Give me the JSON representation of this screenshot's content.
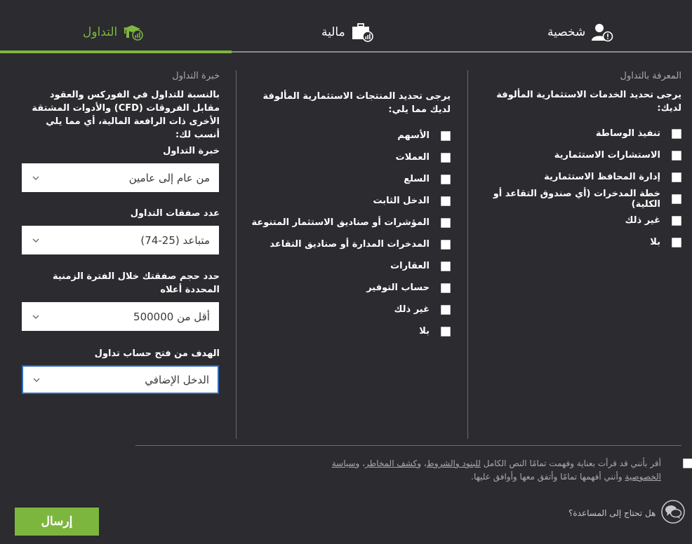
{
  "tabs": {
    "trading": "التداول",
    "finance": "مالية",
    "personal": "شخصية"
  },
  "services": {
    "title": "المعرفة بالتداول",
    "prompt": "يرجى تحديد الخدمات الاستثمارية المألوفة لديك:",
    "items": [
      "تنفيذ الوساطة",
      "الاستشارات الاستثمارية",
      "إدارة المحافظ الاستثمارية",
      "خطة المدخرات (أي صندوق التقاعد أو الكلية)",
      "غير ذلك",
      "بلا"
    ]
  },
  "products": {
    "prompt": "يرجى تحديد المنتجات الاستثمارية المألوفة لديك مما يلي:",
    "items": [
      "الأسهم",
      "العملات",
      "السلع",
      "الدخل الثابت",
      "المؤشرات أو صناديق الاستثمار المتنوعة",
      "المدخرات المدارة أو صناديق التقاعد",
      "العقارات",
      "حساب التوفير",
      "غير ذلك",
      "بلا"
    ]
  },
  "experience": {
    "title": "خبرة التداول",
    "prompt": "بالنسبة للتداول في الفوركس والعقود مقابل الفروقات (CFD) والأدوات المشتقة الأخرى ذات الرافعة المالية، أي مما يلي أنسب لك:",
    "fields": [
      {
        "label": "خبرة التداول",
        "value": "من عام إلى عامين"
      },
      {
        "label": "عدد صفقات التداول",
        "value": "متباعد (25-74)"
      },
      {
        "label": "حدد حجم صفقتك خلال الفترة الزمنية المحددة أعلاه",
        "value": "أقل من 500000"
      },
      {
        "label": "الهدف من فتح حساب تداول",
        "value": "الدخل الإضافي"
      }
    ]
  },
  "agreement": {
    "part1": "أقر بأنني قد قرأت بعناية وفهمت تمامًا النص الكامل ",
    "link1": "للبنود والشروط",
    "sep1": "، و",
    "link2": "كشف المخاطر",
    "sep2": "، و",
    "link3": "سياسة الخصوصية",
    "part2": " وأنني أفهمها تمامًا وأتفق معها وأوافق عليها."
  },
  "submit_label": "إرسال",
  "help_label": "هل تحتاج إلى المساعدة؟",
  "colors": {
    "accent": "#7db63f",
    "background": "#2b2b30",
    "focus": "#2e6bb8"
  },
  "icons": [
    "graduation-cap-chart-icon",
    "briefcase-chart-icon",
    "user-alert-icon",
    "chevron-down-icon",
    "chat-bubbles-icon"
  ]
}
